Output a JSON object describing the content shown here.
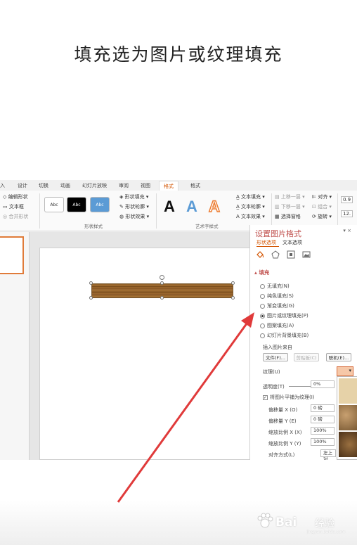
{
  "caption": "填充选为图片或纹理填充",
  "ribbon": {
    "tabs": [
      "入",
      "设计",
      "切换",
      "动画",
      "幻灯片放映",
      "审阅",
      "视图",
      "格式",
      "格式"
    ],
    "active_tab": "格式",
    "left_commands": [
      "编辑形状",
      "文本框",
      "合并形状"
    ],
    "style_boxes": [
      "Abc",
      "Abc",
      "Abc"
    ],
    "shape_commands": [
      "形状填充",
      "形状轮廓",
      "形状效果"
    ],
    "shape_group_label": "形状样式",
    "wordart_letters": [
      "A",
      "A",
      "A"
    ],
    "text_commands": [
      "文本填充",
      "文本轮廓",
      "文本效果"
    ],
    "wordart_group_label": "艺术字样式",
    "arrange_commands": [
      "上移一层",
      "下移一层",
      "选择窗格"
    ],
    "align_commands": [
      "对齐",
      "组合",
      "旋转"
    ],
    "size_values": [
      "0.9",
      "12."
    ]
  },
  "pane": {
    "title": "设置图片格式",
    "close": "▾ ×",
    "tabs": [
      "形状选项",
      "文本选项"
    ],
    "section": "▴ 填充",
    "fill_options": [
      "无填充(N)",
      "纯色填充(S)",
      "渐变填充(G)",
      "图片或纹理填充(P)",
      "图案填充(A)",
      "幻灯片背景填充(B)"
    ],
    "selected_option": 3,
    "insert_from": "插入图片来自",
    "file_button": "文件(F)...",
    "clipboard_button": "剪贴板(C)",
    "online_button": "联机(E)...",
    "texture_label": "纹理(U)",
    "transparency_label": "透明度(T)",
    "transparency_value": "0%",
    "tile_label": "将图片平铺为纹理(I)",
    "offset_x_label": "偏移量 X (O)",
    "offset_x_value": "0 磅",
    "offset_y_label": "偏移量 Y (E)",
    "offset_y_value": "0 磅",
    "scale_x_label": "缩放比例 X (X)",
    "scale_x_value": "100%",
    "scale_y_label": "缩放比例 Y (Y)",
    "scale_y_value": "100%",
    "align_label": "对齐方式(L)",
    "align_value": "左上对"
  },
  "watermark": {
    "brand": "Bai",
    "brand2": "经验",
    "sub": "jingyan.baidu.com"
  },
  "colors": {
    "accent": "#d35400",
    "arrow": "#e03a3a",
    "pane_title": "#c0504d"
  }
}
